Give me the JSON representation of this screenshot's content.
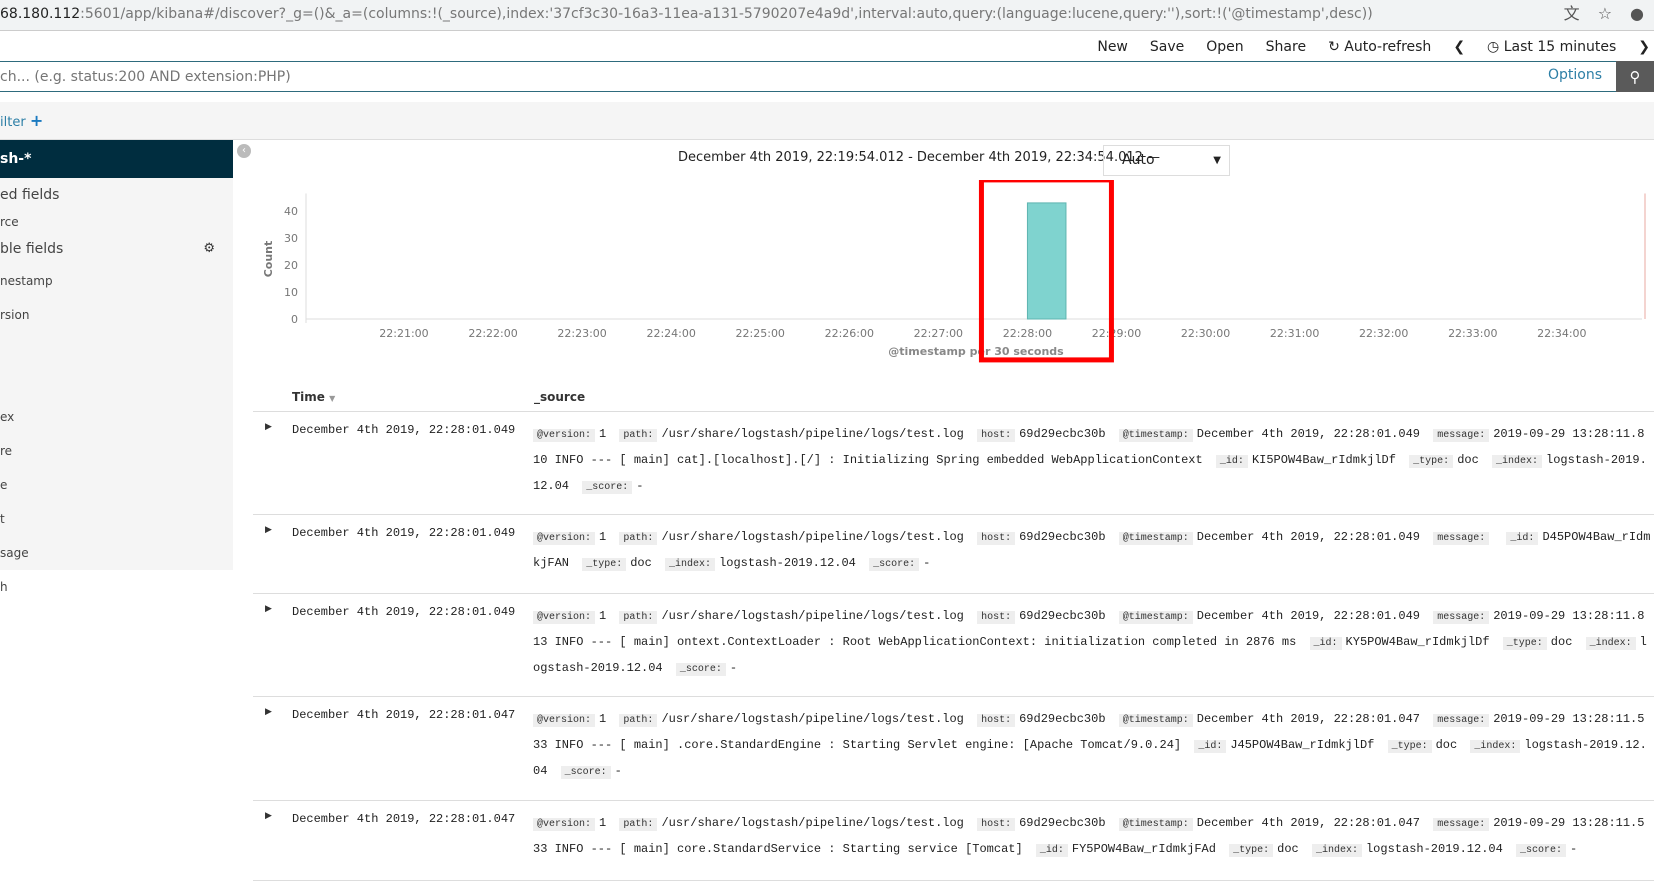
{
  "browser": {
    "url_host": "68.180.112",
    "url_rest": ":5601/app/kibana#/discover?_g=()&_a=(columns:!(_source),index:'37cf3c30-16a3-11ea-a131-5790207e4a9d',interval:auto,query:(language:lucene,query:''),sort:!('@timestamp',desc))",
    "icons": [
      "translate-icon",
      "star-icon",
      "account-icon"
    ]
  },
  "nav": {
    "new": "New",
    "save": "Save",
    "open": "Open",
    "share": "Share",
    "auto_refresh": "Auto-refresh",
    "time_range": "Last 15 minutes"
  },
  "search": {
    "placeholder": "ch... (e.g. status:200 AND extension:PHP)",
    "options": "Options"
  },
  "filter": {
    "label": "ilter"
  },
  "sidebar": {
    "index_pattern": "sh-*",
    "selected_title": "ed fields",
    "selected": [
      "rce"
    ],
    "available_title": "ble fields",
    "available": [
      "nestamp",
      "rsion",
      "",
      "",
      "ex",
      "re",
      "e",
      "t",
      "sage",
      "h"
    ]
  },
  "histogram": {
    "range": "December 4th 2019, 22:19:54.012 - December 4th 2019, 22:34:54.012 —",
    "interval": "Auto"
  },
  "chart_data": {
    "type": "bar",
    "ylabel": "Count",
    "xlabel": "@timestamp per 30 seconds",
    "ylim": [
      0,
      45
    ],
    "yticks": [
      0,
      10,
      20,
      30,
      40
    ],
    "xrange": [
      "22:19:54",
      "22:34:54"
    ],
    "xticks": [
      "22:21:00",
      "22:22:00",
      "22:23:00",
      "22:24:00",
      "22:25:00",
      "22:26:00",
      "22:27:00",
      "22:28:00",
      "22:29:00",
      "22:30:00",
      "22:31:00",
      "22:32:00",
      "22:33:00",
      "22:34:00"
    ],
    "bars": [
      {
        "start": "22:28:00",
        "end": "22:28:30",
        "value": 43
      }
    ],
    "bar_color": "#7fd3cf",
    "highlight_color": "#ff0000"
  },
  "table": {
    "time_header": "Time",
    "source_header": "_source",
    "rows": [
      {
        "time": "December 4th 2019, 22:28:01.049",
        "fields": [
          {
            "k": "@version:",
            "v": "1"
          },
          {
            "k": "path:",
            "v": "/usr/share/logstash/pipeline/logs/test.log"
          },
          {
            "k": "host:",
            "v": "69d29ecbc30b"
          },
          {
            "k": "@timestamp:",
            "v": "December 4th 2019, 22:28:01.049"
          },
          {
            "k": "message:",
            "v": "2019-09-29 13:28:11.810 INFO --- [ main] cat].[localhost].[/] : Initializing Spring embedded WebApplicationContext"
          },
          {
            "k": "_id:",
            "v": "KI5POW4Baw_rIdmkjlDf"
          },
          {
            "k": "_type:",
            "v": "doc"
          },
          {
            "k": "_index:",
            "v": "logstash-2019.12.04"
          },
          {
            "k": "_score:",
            "v": "-"
          }
        ]
      },
      {
        "time": "December 4th 2019, 22:28:01.049",
        "fields": [
          {
            "k": "@version:",
            "v": "1"
          },
          {
            "k": "path:",
            "v": "/usr/share/logstash/pipeline/logs/test.log"
          },
          {
            "k": "host:",
            "v": "69d29ecbc30b"
          },
          {
            "k": "@timestamp:",
            "v": "December 4th 2019, 22:28:01.049"
          },
          {
            "k": "message:",
            "v": ""
          },
          {
            "k": "_id:",
            "v": "D45POW4Baw_rIdmkjFAN"
          },
          {
            "k": "_type:",
            "v": "doc"
          },
          {
            "k": "_index:",
            "v": "logstash-2019.12.04"
          },
          {
            "k": "_score:",
            "v": "-"
          }
        ]
      },
      {
        "time": "December 4th 2019, 22:28:01.049",
        "fields": [
          {
            "k": "@version:",
            "v": "1"
          },
          {
            "k": "path:",
            "v": "/usr/share/logstash/pipeline/logs/test.log"
          },
          {
            "k": "host:",
            "v": "69d29ecbc30b"
          },
          {
            "k": "@timestamp:",
            "v": "December 4th 2019, 22:28:01.049"
          },
          {
            "k": "message:",
            "v": "2019-09-29 13:28:11.813 INFO --- [ main] ontext.ContextLoader : Root WebApplicationContext: initialization completed in 2876 ms"
          },
          {
            "k": "_id:",
            "v": "KY5POW4Baw_rIdmkjlDf"
          },
          {
            "k": "_type:",
            "v": "doc"
          },
          {
            "k": "_index:",
            "v": "logstash-2019.12.04"
          },
          {
            "k": "_score:",
            "v": "-"
          }
        ]
      },
      {
        "time": "December 4th 2019, 22:28:01.047",
        "fields": [
          {
            "k": "@version:",
            "v": "1"
          },
          {
            "k": "path:",
            "v": "/usr/share/logstash/pipeline/logs/test.log"
          },
          {
            "k": "host:",
            "v": "69d29ecbc30b"
          },
          {
            "k": "@timestamp:",
            "v": "December 4th 2019, 22:28:01.047"
          },
          {
            "k": "message:",
            "v": "2019-09-29 13:28:11.533 INFO --- [ main] .core.StandardEngine : Starting Servlet engine: [Apache Tomcat/9.0.24]"
          },
          {
            "k": "_id:",
            "v": "J45POW4Baw_rIdmkjlDf"
          },
          {
            "k": "_type:",
            "v": "doc"
          },
          {
            "k": "_index:",
            "v": "logstash-2019.12.04"
          },
          {
            "k": "_score:",
            "v": "-"
          }
        ]
      },
      {
        "time": "December 4th 2019, 22:28:01.047",
        "fields": [
          {
            "k": "@version:",
            "v": "1"
          },
          {
            "k": "path:",
            "v": "/usr/share/logstash/pipeline/logs/test.log"
          },
          {
            "k": "host:",
            "v": "69d29ecbc30b"
          },
          {
            "k": "@timestamp:",
            "v": "December 4th 2019, 22:28:01.047"
          },
          {
            "k": "message:",
            "v": "2019-09-29 13:28:11.533 INFO --- [ main] core.StandardService : Starting service [Tomcat]"
          },
          {
            "k": "_id:",
            "v": "FY5POW4Baw_rIdmkjFAd"
          },
          {
            "k": "_type:",
            "v": "doc"
          },
          {
            "k": "_index:",
            "v": "logstash-2019.12.04"
          },
          {
            "k": "_score:",
            "v": "-"
          }
        ]
      }
    ]
  }
}
